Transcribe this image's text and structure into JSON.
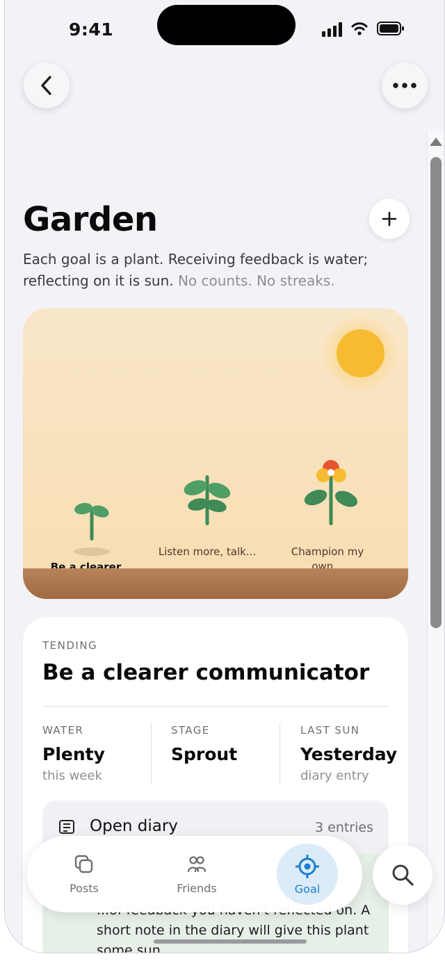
{
  "status_bar": {
    "time": "9:41"
  },
  "header": {
    "title": "Garden",
    "subtitle_main": "Each goal is a plant. Receiving feedback is water; reflecting on it is sun.",
    "subtitle_muted": "No counts. No streaks."
  },
  "icons": {
    "back": "chevron-left-icon",
    "more": "ellipsis-icon",
    "add": "plus-icon",
    "sun": "sun-icon",
    "diary": "list-icon",
    "posts": "stacked-squares-icon",
    "friends": "people-icon",
    "goal": "target-icon",
    "search": "search-icon"
  },
  "garden": {
    "plants": [
      {
        "label": "Be a clearer...",
        "stage": "sprout",
        "active": true
      },
      {
        "label": "Listen more, talk...",
        "stage": "leafy",
        "active": false
      },
      {
        "label": "Champion my own...",
        "stage": "flower",
        "active": false
      }
    ]
  },
  "tending": {
    "eyebrow": "TENDING",
    "title": "Be a clearer communicator",
    "stats": [
      {
        "label": "WATER",
        "value": "Plenty",
        "sub": "this week"
      },
      {
        "label": "STAGE",
        "value": "Sprout",
        "sub": ""
      },
      {
        "label": "LAST SUN",
        "value": "Yesterday",
        "sub": "diary entry"
      }
    ],
    "diary": {
      "label": "Open diary",
      "count": "3 entries"
    },
    "hint": "...of feedback you haven't reflected on. A short note in the diary will give this plant some sun."
  },
  "nav": {
    "tabs": [
      {
        "label": "Posts",
        "active": false
      },
      {
        "label": "Friends",
        "active": false
      },
      {
        "label": "Goal",
        "active": true
      }
    ]
  },
  "colors": {
    "accent": "#1a7fd1",
    "sun": "#f7bb33",
    "leaf": "#4f9e66",
    "stem": "#3f8a55",
    "ground": "#a87149",
    "flower": "#e7552f"
  }
}
